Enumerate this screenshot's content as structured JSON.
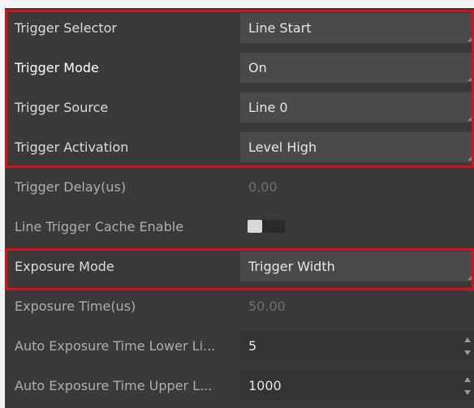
{
  "colors": {
    "highlight_border": "#d8101a",
    "panel_bg": "#3a3a3a"
  },
  "rows": [
    {
      "label": "Trigger Selector",
      "value": "Line Start",
      "control": "dropdown"
    },
    {
      "label": "Trigger Mode",
      "value": "On",
      "control": "dropdown"
    },
    {
      "label": "Trigger Source",
      "value": "Line 0",
      "control": "dropdown"
    },
    {
      "label": "Trigger Activation",
      "value": "Level High",
      "control": "dropdown"
    },
    {
      "label": "Trigger Delay(us)",
      "value": "0.00",
      "control": "input-disabled"
    },
    {
      "label": "Line Trigger Cache Enable",
      "value": "off",
      "control": "toggle"
    },
    {
      "label": "Exposure Mode",
      "value": "Trigger Width",
      "control": "dropdown"
    },
    {
      "label": "Exposure Time(us)",
      "value": "50.00",
      "control": "input-disabled"
    },
    {
      "label": "Auto Exposure Time Lower Li...",
      "value": "5",
      "control": "spinbox"
    },
    {
      "label": "Auto Exposure Time Upper L...",
      "value": "1000",
      "control": "spinbox"
    }
  ]
}
